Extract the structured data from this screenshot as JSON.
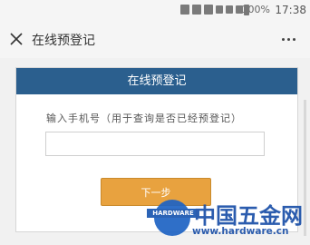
{
  "status_bar": {
    "battery": "100%",
    "time": "17:38"
  },
  "title_bar": {
    "title": "在线预登记"
  },
  "form": {
    "header": "在线预登记",
    "phone_label": "输入手机号（用于查询是否已经预登记）",
    "phone_value": "",
    "next_button": "下一步"
  },
  "watermark": {
    "badge_text": "HARDWARE",
    "name": "中国五金网",
    "url": "www.hardware.cn"
  }
}
